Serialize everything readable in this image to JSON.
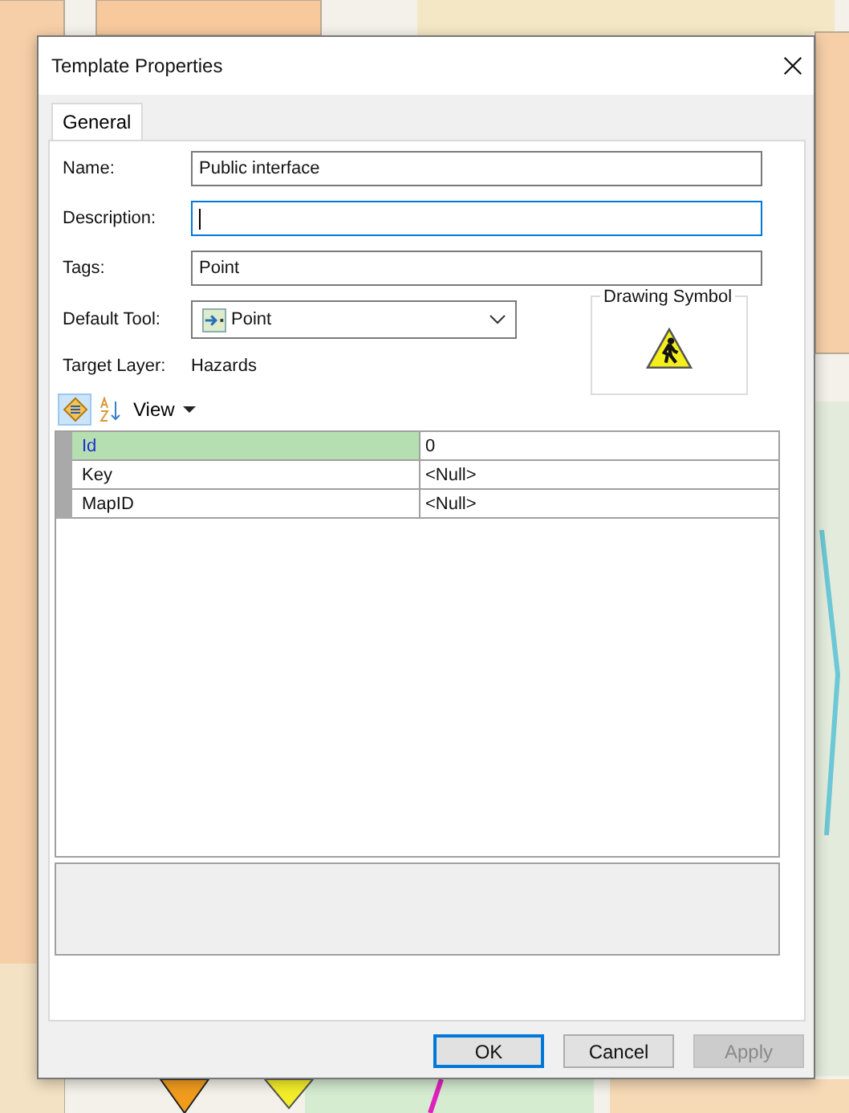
{
  "window": {
    "title": "Template Properties"
  },
  "tabs": [
    {
      "label": "General",
      "selected": true
    }
  ],
  "fields": [
    {
      "label": "Name:",
      "value": "Public interface",
      "focused": false
    },
    {
      "label": "Description:",
      "focused": true
    },
    {
      "label": "Tags:",
      "value": "Point",
      "focused": false
    }
  ],
  "default_tool": {
    "label": "Default Tool:",
    "value": "Point"
  },
  "target_layer": {
    "label": "Target Layer:",
    "value": "Hazards"
  },
  "drawing_symbol": {
    "title": "Drawing Symbol"
  },
  "toolbar": {
    "categorized_selected": true,
    "view_label": "View"
  },
  "grid_rows": [
    {
      "name": "Id",
      "value": "0",
      "selected": true
    },
    {
      "name": "Key",
      "value": "<Null>",
      "selected": false
    },
    {
      "name": "MapID",
      "value": "<Null>",
      "selected": false
    }
  ],
  "buttons": [
    {
      "label": "OK",
      "default": true,
      "disabled": false
    },
    {
      "label": "Cancel",
      "default": false,
      "disabled": false
    },
    {
      "label": "Apply",
      "default": false,
      "disabled": true
    }
  ]
}
